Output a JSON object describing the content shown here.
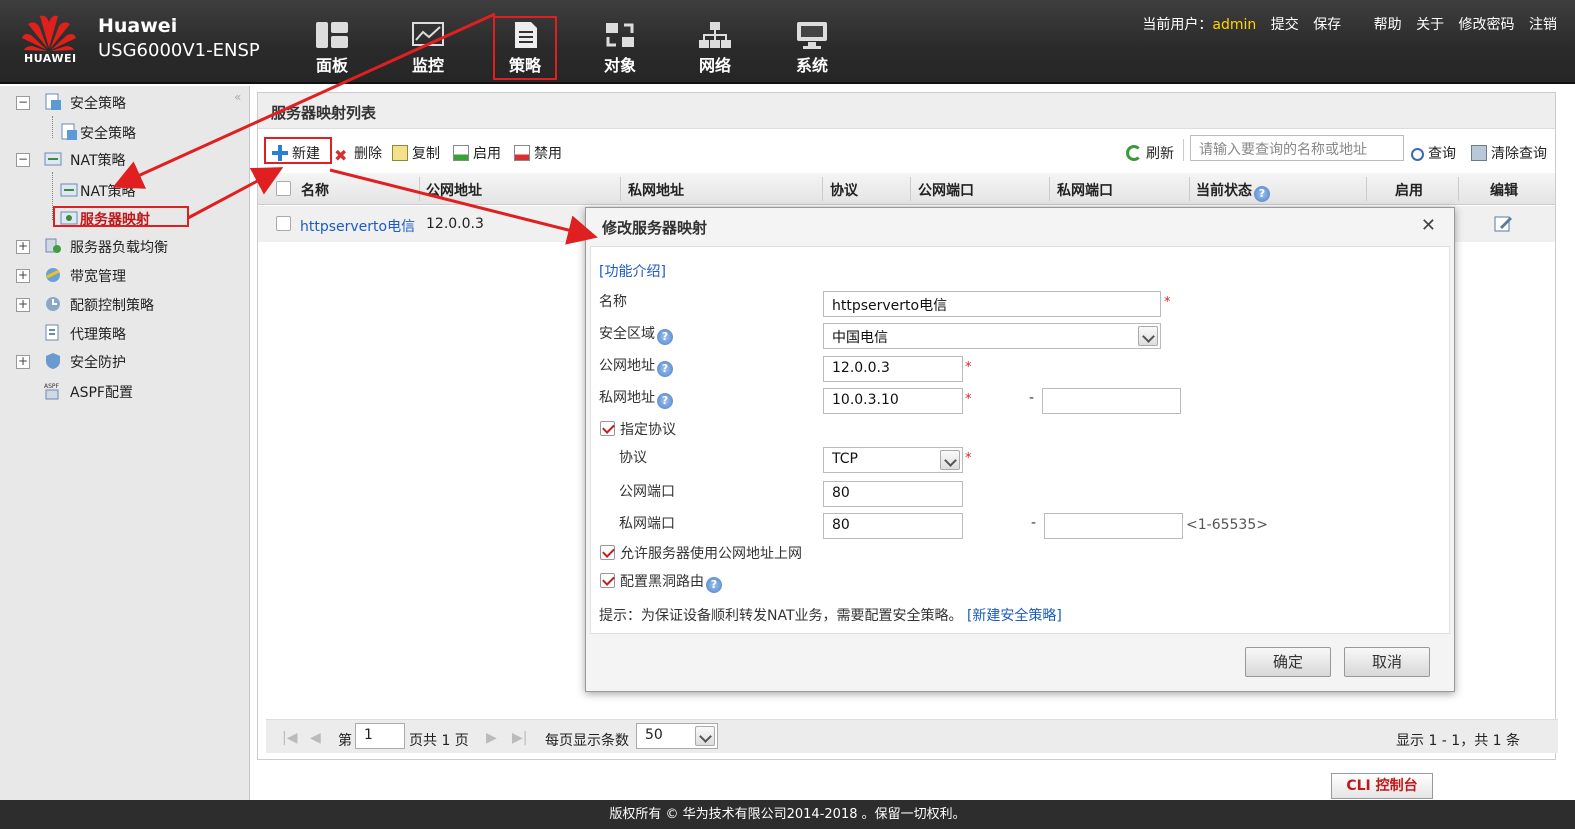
{
  "header": {
    "logo_text": "HUAWEI",
    "brand": "Huawei",
    "model": "USG6000V1-ENSP",
    "nav": [
      {
        "label": "面板",
        "icon": "dashboard-icon"
      },
      {
        "label": "监控",
        "icon": "monitor-icon"
      },
      {
        "label": "策略",
        "icon": "policy-icon"
      },
      {
        "label": "对象",
        "icon": "object-icon"
      },
      {
        "label": "网络",
        "icon": "network-icon"
      },
      {
        "label": "系统",
        "icon": "system-icon"
      }
    ],
    "active_nav": "策略",
    "user_label": "当前用户：",
    "user": "admin",
    "links": [
      "提交",
      "保存",
      "帮助",
      "关于",
      "修改密码",
      "注销"
    ]
  },
  "sidebar": {
    "items": [
      {
        "label": "安全策略",
        "expanded": true
      },
      {
        "label": "安全策略"
      },
      {
        "label": "NAT策略",
        "expanded": true
      },
      {
        "label": "NAT策略"
      },
      {
        "label": "服务器映射",
        "selected": true
      },
      {
        "label": "服务器负载均衡"
      },
      {
        "label": "带宽管理"
      },
      {
        "label": "配额控制策略"
      },
      {
        "label": "代理策略"
      },
      {
        "label": "安全防护"
      },
      {
        "label": "ASPF配置"
      }
    ]
  },
  "main": {
    "title": "服务器映射列表",
    "toolbar": {
      "new": "新建",
      "delete": "删除",
      "copy": "复制",
      "enable": "启用",
      "disable": "禁用",
      "refresh": "刷新",
      "search_placeholder": "请输入要查询的名称或地址",
      "query": "查询",
      "clear": "清除查询"
    },
    "columns": [
      "名称",
      "公网地址",
      "私网地址",
      "协议",
      "公网端口",
      "私网端口",
      "当前状态",
      "启用",
      "编辑"
    ],
    "rows": [
      {
        "name": "httpserverto电信",
        "public": "12.0.0.3"
      }
    ],
    "pager": {
      "page_label": "第",
      "page": "1",
      "total_label": "页共 1 页",
      "per_page_label": "每页显示条数",
      "per_page": "50",
      "summary": "显示 1 - 1，共 1 条"
    }
  },
  "dialog": {
    "title": "修改服务器映射",
    "intro": "[功能介绍]",
    "name_label": "名称",
    "name_value": "httpserverto电信",
    "zone_label": "安全区域",
    "zone_value": "中国电信",
    "public_label": "公网地址",
    "public_value": "12.0.0.3",
    "private_label": "私网地址",
    "private_value": "10.0.3.10",
    "dash": "-",
    "specify_protocol": "指定协议",
    "protocol_label": "协议",
    "protocol_value": "TCP",
    "public_port_label": "公网端口",
    "public_port_value": "80",
    "private_port_label": "私网端口",
    "private_port_value": "80",
    "port_range": "<1-65535>",
    "allow_public": "允许服务器使用公网地址上网",
    "blackhole": "配置黑洞路由",
    "hint": "提示：为保证设备顺利转发NAT业务，需要配置安全策略。",
    "hint_link": "[新建安全策略]",
    "ok": "确定",
    "cancel": "取消"
  },
  "footer": {
    "copyright": "版权所有 © 华为技术有限公司2014-2018 。保留一切权利。",
    "cli": "CLI 控制台"
  },
  "colors": {
    "header_bg": "#2f2f2f",
    "annotation_red": "#e02020",
    "link_blue": "#1b5bc4",
    "user_yellow": "#ffd400"
  }
}
